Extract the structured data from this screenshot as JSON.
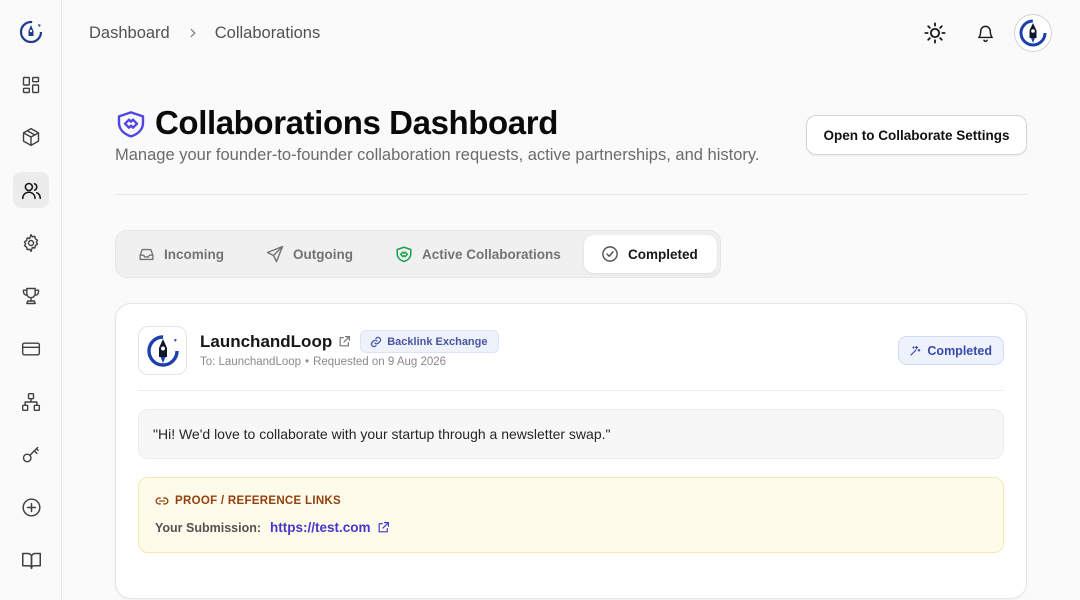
{
  "breadcrumb": {
    "items": [
      "Dashboard",
      "Collaborations"
    ]
  },
  "header": {
    "title": "Collaborations Dashboard",
    "subtitle": "Manage your founder-to-founder collaboration requests, active partnerships, and history.",
    "settings_button": "Open to Collaborate Settings"
  },
  "sidebar": {
    "items": [
      {
        "icon": "dashboard-grid-icon"
      },
      {
        "icon": "box-icon"
      },
      {
        "icon": "users-icon",
        "active": true
      },
      {
        "icon": "gear-icon"
      },
      {
        "icon": "trophy-icon"
      },
      {
        "icon": "credit-card-icon"
      },
      {
        "icon": "network-icon"
      },
      {
        "icon": "key-icon"
      },
      {
        "icon": "plus-circle-icon"
      },
      {
        "icon": "book-icon"
      }
    ]
  },
  "topbar": {
    "icons": [
      "sun-icon",
      "bell-icon",
      "avatar"
    ]
  },
  "tabs": [
    {
      "label": "Incoming",
      "icon": "inbox-icon"
    },
    {
      "label": "Outgoing",
      "icon": "send-icon"
    },
    {
      "label": "Active Collaborations",
      "icon": "handshake-icon"
    },
    {
      "label": "Completed",
      "icon": "check-circle-icon",
      "active": true
    }
  ],
  "card": {
    "partner_name": "LaunchandLoop",
    "type_badge": "Backlink Exchange",
    "meta_to": "To: LaunchandLoop",
    "meta_dot": "•",
    "meta_requested": "Requested on 9 Aug 2026",
    "status": "Completed",
    "message": "\"Hi! We'd love to collaborate with your startup through a newsletter swap.\"",
    "proof_heading": "PROOF / REFERENCE LINKS",
    "proof_label": "Your Submission:",
    "proof_link": "https://test.com"
  },
  "colors": {
    "accent": "#4338ca",
    "status_bg": "#edf2fd",
    "proof_bg": "#fffbeb",
    "proof_heading": "#92400e",
    "handshake_green": "#16a34a",
    "handshake_indigo": "#4f46e5"
  }
}
